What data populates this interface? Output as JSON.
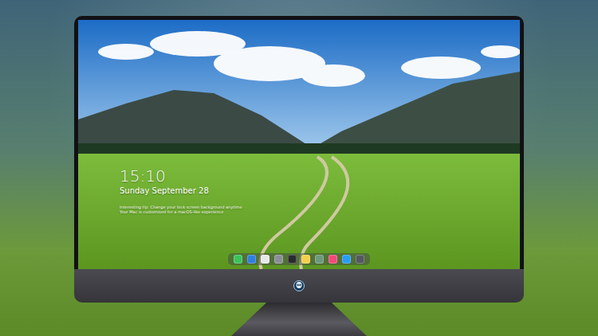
{
  "lock_screen": {
    "time": "15:10",
    "date": "Sunday September 28",
    "tip": [
      "Interesting tip: Change your lock screen background anytime",
      "Your Mac is customised for a macOS-like experience"
    ]
  },
  "dock": [
    {
      "color": "#3cc35a"
    },
    {
      "color": "#2f7fe0"
    },
    {
      "color": "#e8e8ea"
    },
    {
      "color": "#8a8f96"
    },
    {
      "color": "#2b2b2e"
    },
    {
      "color": "#f5d04a"
    },
    {
      "color": "#6d9a7a"
    },
    {
      "color": "#f04a7a"
    },
    {
      "color": "#2a9cf2"
    },
    {
      "color": "#55585e"
    }
  ]
}
